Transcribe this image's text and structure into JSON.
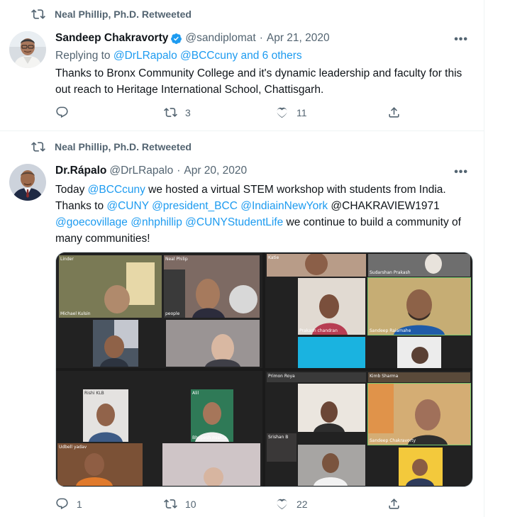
{
  "tweets": [
    {
      "retweeted_by": "Neal Phillip, Ph.D. Retweeted",
      "author_name": "Sandeep Chakravorty",
      "verified": true,
      "handle": "@sandiplomat",
      "separator": "·",
      "date": "Apr 21, 2020",
      "replying_to_prefix": "Replying to ",
      "replying_to_links": "@DrLRapalo @BCCcuny and 6 others",
      "text": "Thanks to Bronx Community College and it's dynamic leadership and faculty for this out reach to Heritage International School, Chattisgarh.",
      "replies": "",
      "retweets": "3",
      "likes": "11",
      "more": "•••"
    },
    {
      "retweeted_by": "Neal Phillip, Ph.D. Retweeted",
      "author_name": "Dr.Rápalo",
      "handle": "@DrLRapalo",
      "separator": "·",
      "date": "Apr 20, 2020",
      "text_parts": {
        "p1": "Today ",
        "m1": "@BCCcuny",
        "p2": " we hosted a virtual STEM workshop with students from India. Thanks to ",
        "m2": "@CUNY",
        "s1": " ",
        "m3": "@president_BCC",
        "s2": " ",
        "m4": "@IndiainNewYork",
        "p3": " @CHAKRAVIEW1971 ",
        "m5": "@goecovillage",
        "s3": " ",
        "m6": "@nhphillip",
        "s4": " ",
        "m7": "@CUNYStudentLife",
        "p4": "  we continue to build a community of many communities!"
      },
      "replies": "1",
      "retweets": "10",
      "likes": "22",
      "more": "•••"
    }
  ],
  "media_labels": {
    "q1_t1": "Linder",
    "q1_t2": "Neal Philip",
    "q1_t3": "Michael Kulsin",
    "q1_t4": "people",
    "q2_t1": "Katie",
    "q2_t2": "Sudarshan Prakash",
    "q2_t3": "Prakash chandran",
    "q2_t4": "Sandeep Raiamahe",
    "q3_t1": "Rishi KLB",
    "q3_t2": "Alil",
    "q3_t3": "Udbell yadav",
    "q3_t4": "Bhupesh mishra",
    "q4_t1": "Primon Roya",
    "q4_t2": "Kimb Sharma",
    "q4_t3": "Sandeep Chakravorty",
    "q4_t4": "Srishan B"
  },
  "colors": {
    "link": "#1d9bf0",
    "secondary_text": "#536471",
    "verified": "#1d9bf0"
  }
}
